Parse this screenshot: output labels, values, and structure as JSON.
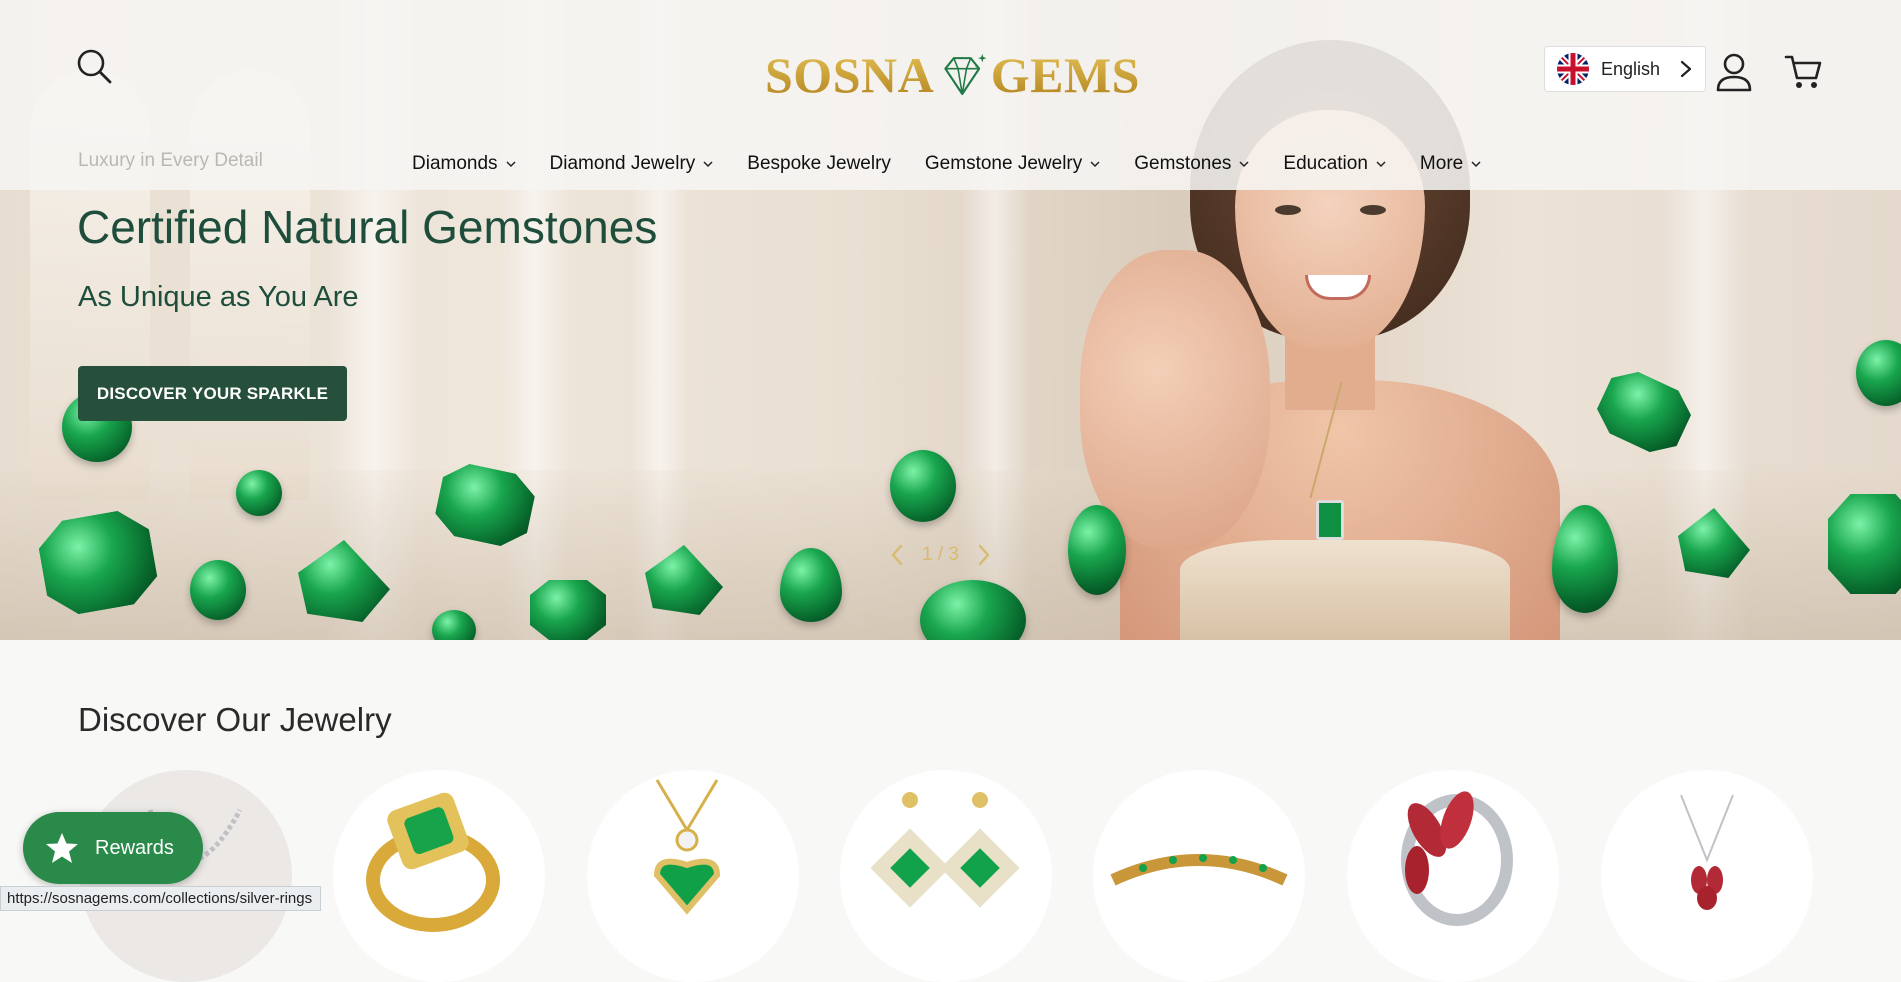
{
  "header": {
    "logo_left": "SOSNA",
    "logo_right": "GEMS",
    "tagline": "Luxury in Every Detail",
    "language": {
      "label": "English"
    },
    "icons": [
      "search-icon",
      "user-icon",
      "cart-icon",
      "flag-uk-icon",
      "chevron-right-icon"
    ]
  },
  "nav": {
    "items": [
      {
        "label": "Diamonds",
        "has_dropdown": true
      },
      {
        "label": "Diamond Jewelry",
        "has_dropdown": true
      },
      {
        "label": "Bespoke Jewelry",
        "has_dropdown": false
      },
      {
        "label": "Gemstone Jewelry",
        "has_dropdown": true
      },
      {
        "label": "Gemstones",
        "has_dropdown": true
      },
      {
        "label": "Education",
        "has_dropdown": true
      },
      {
        "label": "More",
        "has_dropdown": true
      }
    ]
  },
  "hero": {
    "title": "Certified Natural Gemstones",
    "subtitle": "As Unique as You Are",
    "cta_label": "DISCOVER YOUR SPARKLE",
    "slide_counter": "1 / 3"
  },
  "jewelry_section": {
    "title": "Discover Our Jewelry",
    "items": [
      {
        "name": "silver-necklace"
      },
      {
        "name": "emerald-gold-ring"
      },
      {
        "name": "emerald-heart-pendant"
      },
      {
        "name": "emerald-drop-earrings"
      },
      {
        "name": "emerald-tennis-bracelet"
      },
      {
        "name": "garnet-silver-ring"
      },
      {
        "name": "garnet-silver-pendant"
      }
    ]
  },
  "rewards": {
    "label": "Rewards"
  },
  "status_bar": {
    "url": "https://sosnagems.com/collections/silver-rings"
  },
  "colors": {
    "brand_green": "#264f3c",
    "heading_green": "#1e4d3c",
    "logo_gold": "#c89a28",
    "rewards_green": "#2a8a4a"
  }
}
